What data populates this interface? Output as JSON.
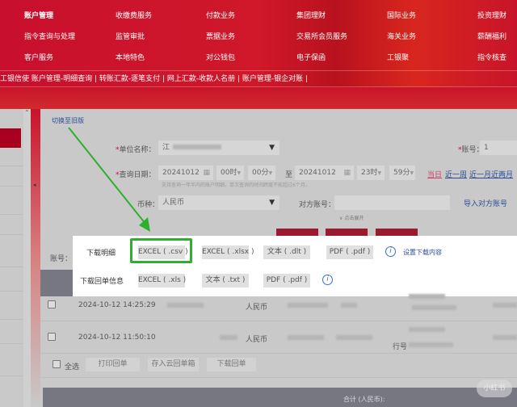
{
  "top_menu": [
    [
      "账户管理",
      "收缴费服务",
      "付款业务",
      "集团理财",
      "国际业务",
      "投资理财"
    ],
    [
      "指令查询与处理",
      "监管审批",
      "票据业务",
      "交易所会员服务",
      "海关业务",
      "薪酬福利"
    ],
    [
      "客户服务",
      "本地特色",
      "对公钱包",
      "电子保函",
      "工银聚",
      "指令核查"
    ]
  ],
  "sub_nav": "工银信使   账户管理-明细查询 | 转账汇款-逐笔支付 | 网上汇款-收款人名册 | 账户管理-银企对账 |",
  "switch_old": "切换至旧版",
  "form": {
    "unit_label": "单位名称：",
    "unit_value": "江",
    "account_label": "账号：",
    "account_value": "1",
    "date_label": "查询日期：",
    "date_from": "20241012",
    "hour_from": "00时",
    "min_from": "00分",
    "to": "至",
    "date_to": "20241012",
    "hour_to": "23时",
    "min_to": "59分",
    "quick": [
      "当日",
      "近一周",
      "近一月",
      "近两月"
    ],
    "hint": "支持查询一年半内的账户明细，单次查询的时间跨度不能超过6个月。",
    "currency_label": "币种：",
    "currency_value": "人民币",
    "counter_label": "对方账号：",
    "import_counter": "导入对方账号",
    "expand": "点击展开",
    "acct_short": "账号："
  },
  "popup": {
    "detail_label": "下载明细",
    "detail_buttons": [
      "EXCEL ( .csv )",
      "EXCEL ( .xlsx )",
      "文本 ( .dlt )",
      "PDF ( .pdf )"
    ],
    "settings_link": "设置下载内容",
    "receipt_label": "下载回单信息",
    "receipt_buttons": [
      "EXCEL ( .xls )",
      "文本 ( .txt )",
      "PDF ( .pdf )"
    ]
  },
  "rows": [
    {
      "time": "2024-10-12  14:25:29",
      "currency": "人民币"
    },
    {
      "time": "2024-10-12  11:50:10",
      "currency": "人民币",
      "bank_no": "行号"
    }
  ],
  "footer": {
    "select_all": "全选",
    "buttons": [
      "打印回单",
      "存入云回单箱",
      "下载回单"
    ],
    "total": "合计 (人民币):"
  },
  "watermark": "小红书",
  "colors": {
    "brand": "#c8102e",
    "highlight": "#2eb02e",
    "link": "#2a4d9a"
  }
}
